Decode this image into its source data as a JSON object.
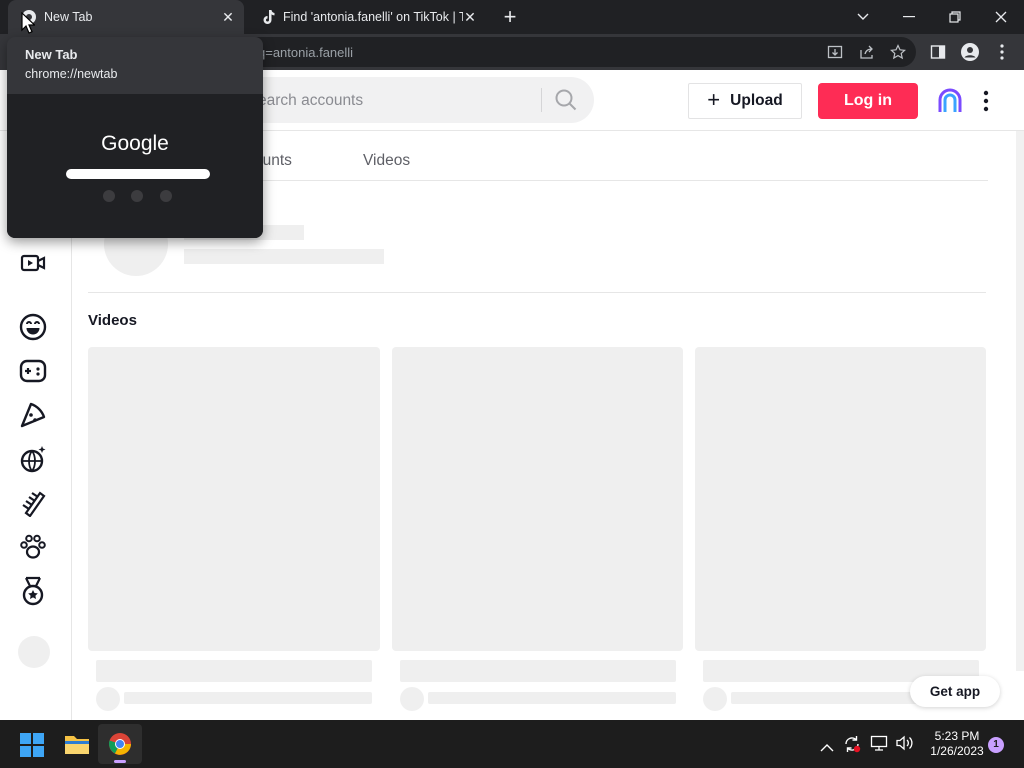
{
  "browser": {
    "tabs": [
      {
        "title": "New Tab",
        "icon": "chrome-icon",
        "active": true
      },
      {
        "title": "Find 'antonia.fanelli' on TikTok | T",
        "icon": "tiktok-icon",
        "active": false
      }
    ],
    "url_visible": "q=antonia.fanelli",
    "hover_card": {
      "title": "New Tab",
      "url": "chrome://newtab",
      "preview_logo": "Google"
    }
  },
  "tiktok": {
    "search_placeholder": "earch accounts",
    "upload_label": "Upload",
    "login_label": "Log in",
    "tabs": [
      "ounts",
      "Videos"
    ],
    "videos_heading": "Videos",
    "get_app_label": "Get app",
    "sidebar_icons": [
      "video-camera-icon",
      "smiley-icon",
      "gamepad-icon",
      "pizza-icon",
      "disco-ball-icon",
      "comb-icon",
      "paw-icon",
      "medal-icon"
    ],
    "colors": {
      "brand_red": "#fe2c55"
    }
  },
  "taskbar": {
    "time": "5:23 PM",
    "date": "1/26/2023",
    "notification_count": "1"
  }
}
